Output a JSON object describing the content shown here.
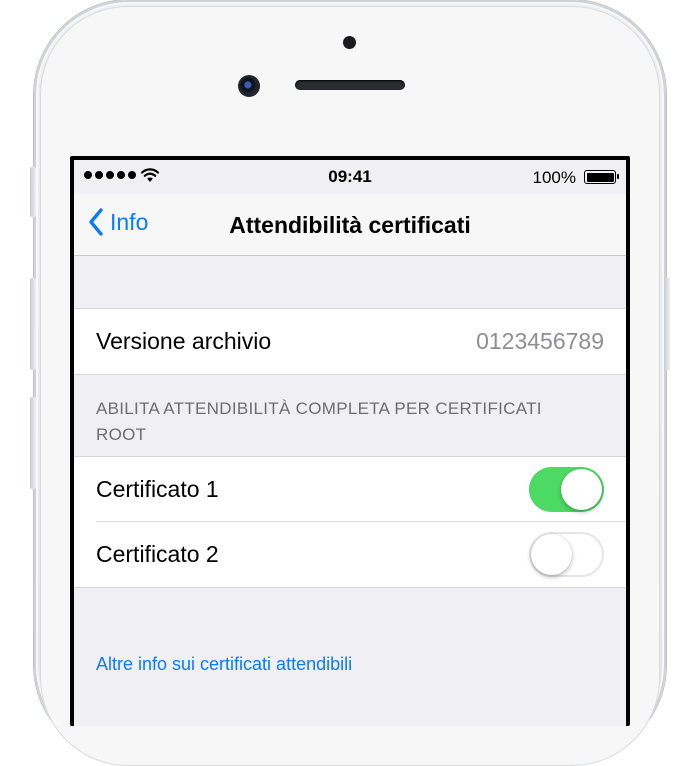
{
  "status_bar": {
    "time": "09:41",
    "battery_percent": "100%",
    "signal_bars": 5,
    "wifi_icon": "wifi-icon",
    "battery_icon": "battery-full-icon"
  },
  "nav": {
    "back_label": "Info",
    "back_icon": "chevron-left-icon",
    "title": "Attendibilità certificati"
  },
  "archive": {
    "label": "Versione archivio",
    "value": "0123456789"
  },
  "section": {
    "header": "ABILITA ATTENDIBILITÀ COMPLETA PER CERTIFICATI ROOT"
  },
  "certificates": [
    {
      "label": "Certificato 1",
      "enabled": true
    },
    {
      "label": "Certificato 2",
      "enabled": false
    }
  ],
  "footer": {
    "link": "Altre info sui certificati attendibili"
  },
  "colors": {
    "accent": "#0a7aff",
    "toggle_on": "#4cd964",
    "background": "#efeff4",
    "secondary_text": "#8e8e93"
  }
}
